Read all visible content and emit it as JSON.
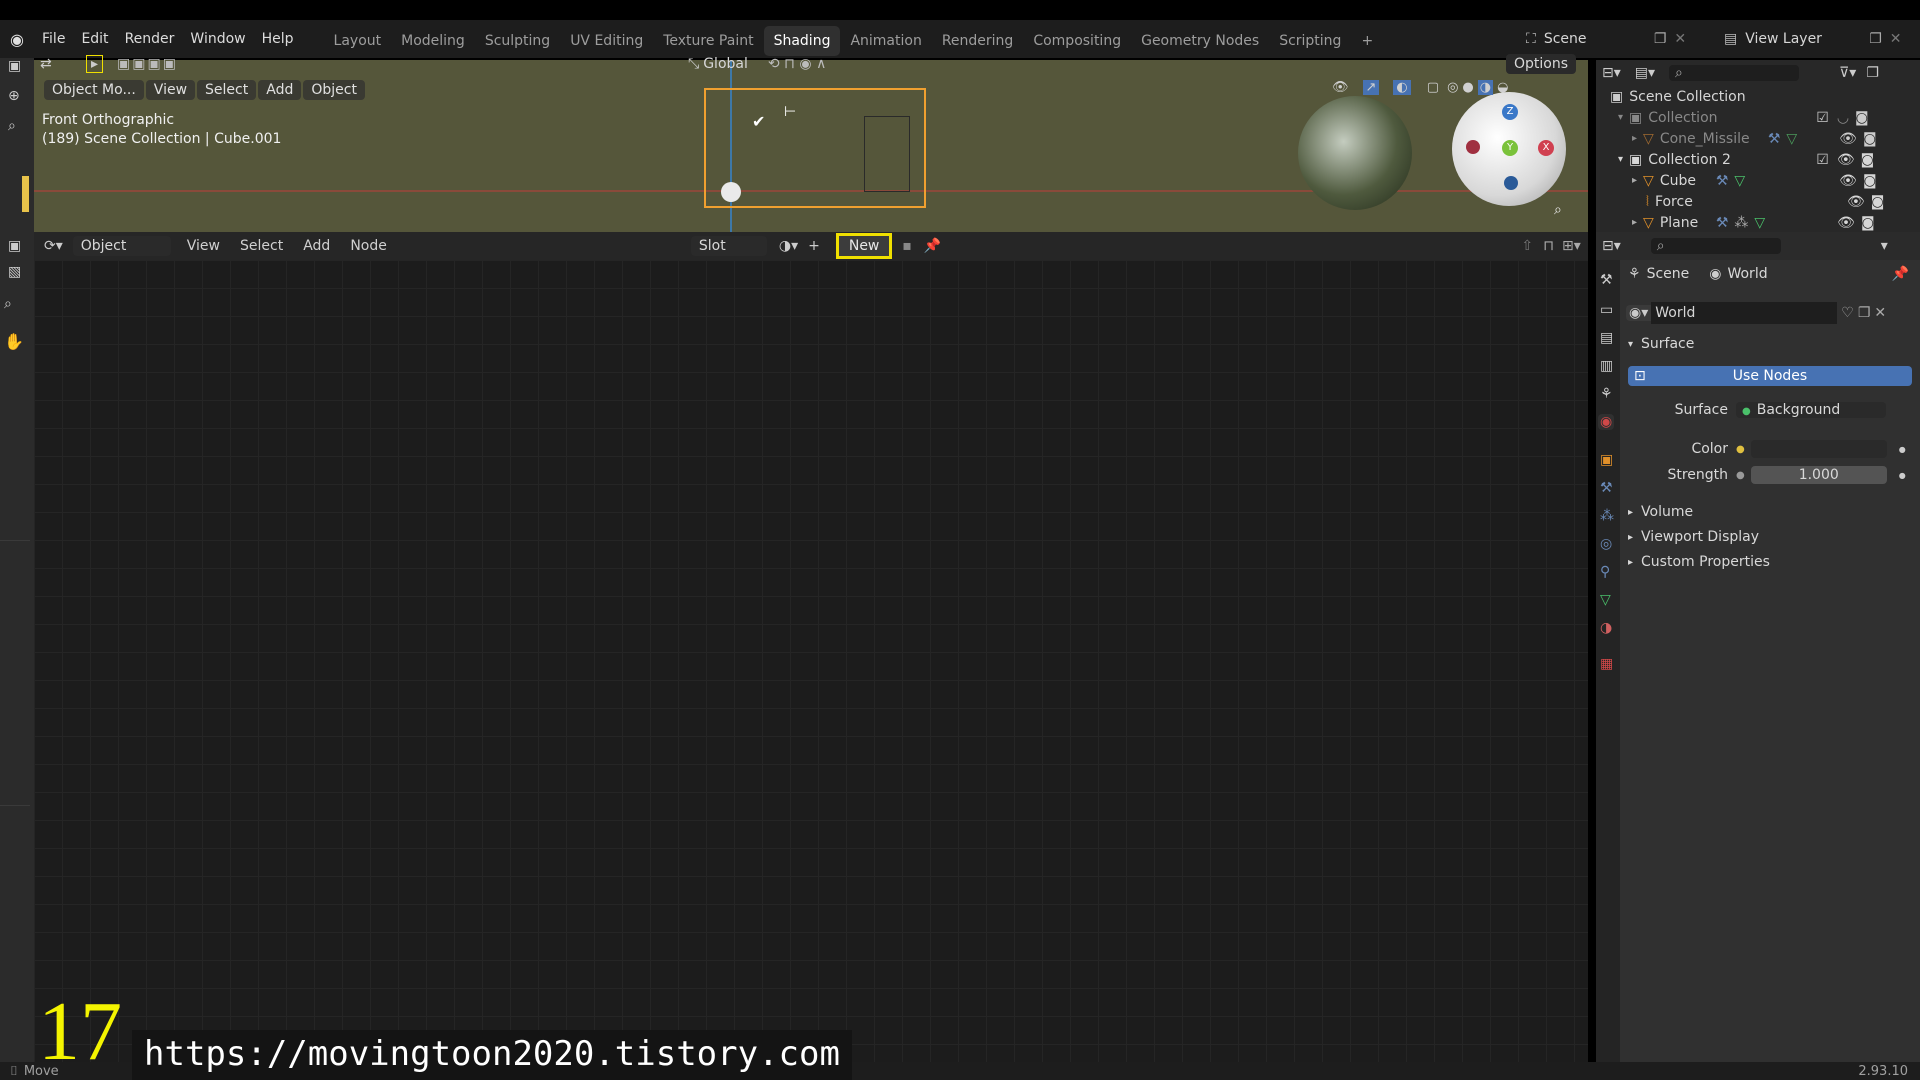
{
  "menu": [
    "File",
    "Edit",
    "Render",
    "Window",
    "Help"
  ],
  "workspaces": [
    "Layout",
    "Modeling",
    "Sculpting",
    "UV Editing",
    "Texture Paint",
    "Shading",
    "Animation",
    "Rendering",
    "Compositing",
    "Geometry Nodes",
    "Scripting"
  ],
  "active_workspace": "Shading",
  "scene_name": "Scene",
  "view_layer": "View Layer",
  "viewport": {
    "mode": "Object Mo...",
    "menus": [
      "View",
      "Select",
      "Add",
      "Object"
    ],
    "transform": "Global",
    "options": "Options",
    "view_name": "Front Orthographic",
    "info": "(189) Scene Collection | Cube.001"
  },
  "node_editor": {
    "type": "Object",
    "menus": [
      "View",
      "Select",
      "Add",
      "Node"
    ],
    "slot": "Slot",
    "new_label": "New"
  },
  "outliner": {
    "root": "Scene Collection",
    "rows": [
      {
        "label": "Collection",
        "dim": true
      },
      {
        "label": "Cone_Missile",
        "dim": true
      },
      {
        "label": "Collection 2",
        "dim": false
      },
      {
        "label": "Cube",
        "dim": false
      },
      {
        "label": "Force",
        "dim": false
      },
      {
        "label": "Plane",
        "dim": false
      }
    ]
  },
  "properties": {
    "breadcrumb_scene": "Scene",
    "breadcrumb_world": "World",
    "world_name": "World",
    "surface_section": "Surface",
    "use_nodes": "Use Nodes",
    "surface_label": "Surface",
    "surface_value": "Background",
    "color_label": "Color",
    "strength_label": "Strength",
    "strength_value": "1.000",
    "collapsed_sections": [
      "Volume",
      "Viewport Display",
      "Custom Properties"
    ]
  },
  "status": {
    "action": "Move",
    "version": "2.93.10"
  },
  "overlay": {
    "number": "17",
    "url": "https://movingtoon2020.tistory.com"
  },
  "colors": {
    "accent_blue": "#4772b3",
    "highlight_yellow": "#f0e000",
    "viewport_bg": "#55563a",
    "selection_orange": "#f0a030"
  }
}
